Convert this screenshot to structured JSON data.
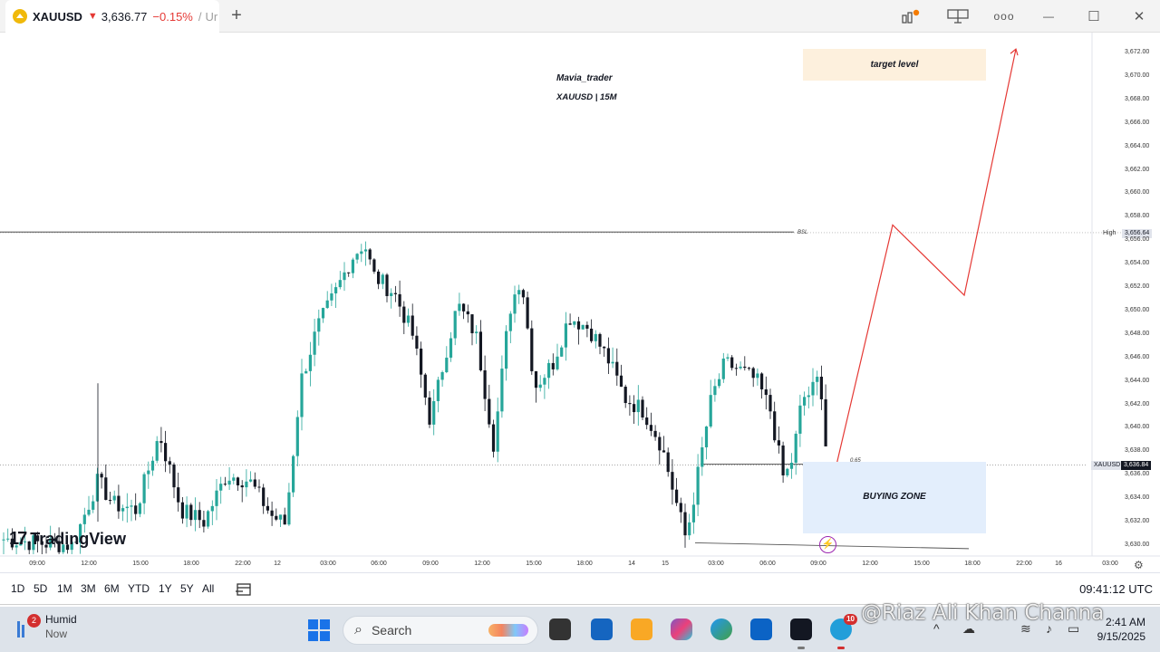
{
  "tab": {
    "symbol": "XAUUSD",
    "arrow": "▼",
    "price": "3,636.77",
    "change": "−0.15%",
    "separator": "/",
    "trail": "Ur"
  },
  "window_controls": {
    "new_tab": "+",
    "more": "ooo",
    "minimize": "—",
    "maximize": "☐",
    "close": "✕"
  },
  "chart": {
    "author": "Mavia_trader",
    "subtitle": "XAUUSD | 15M",
    "target_label": "target level",
    "buying_zone_label": "BUYING ZONE",
    "bsl_label": "BSL",
    "fib_label": "0.65",
    "high_tag": "High",
    "high_value": "3,656.64",
    "price_tag_symbol": "XAUUSD",
    "price_tag_value": "3,636.84",
    "logo_mark": "17",
    "logo_text": "TradingView",
    "zap_icon": "⚡",
    "settings_icon": "⚙",
    "y_ticks": [
      "3,672.00",
      "3,670.00",
      "3,668.00",
      "3,666.00",
      "3,664.00",
      "3,662.00",
      "3,660.00",
      "3,658.00",
      "3,656.00",
      "3,654.00",
      "3,652.00",
      "3,650.00",
      "3,648.00",
      "3,646.00",
      "3,644.00",
      "3,642.00",
      "3,640.00",
      "3,638.00",
      "3,636.00",
      "3,634.00",
      "3,632.00",
      "3,630.00"
    ],
    "x_ticks": [
      "09:00",
      "12:00",
      "15:00",
      "18:00",
      "22:00",
      "12",
      "03:00",
      "06:00",
      "09:00",
      "12:00",
      "15:00",
      "18:00",
      "14",
      "15",
      "03:00",
      "06:00",
      "09:00",
      "12:00",
      "15:00",
      "18:00",
      "22:00",
      "16",
      "03:00"
    ],
    "levels": {
      "bsl": 3656.7,
      "high": 3656.64,
      "current": 3636.84,
      "fib": 3636.9,
      "buy_zone_top": 3637.0,
      "buy_zone_bottom": 3631.0,
      "buy_zone_mid": 3634.2,
      "target_top": 3672.6,
      "target_bottom": 3669.8,
      "low_line_start": 3630.2,
      "low_line_end": 3629.7
    },
    "projection": [
      [
        918,
        3635.2
      ],
      [
        985,
        3657.3
      ],
      [
        1064,
        3651.3
      ],
      [
        1121,
        3672.3
      ]
    ],
    "colors": {
      "bull": "#26a69a",
      "bear": "#131722",
      "projection": "#e53935",
      "buy_zone": "#e3eefc",
      "target_zone": "#fdf0dd"
    }
  },
  "chart_data": {
    "type": "candlestick",
    "title": "XAUUSD | 15M",
    "ylim": [
      3629.0,
      3673.5
    ],
    "y_unit": "USD",
    "anchors": [
      {
        "x": 4,
        "y": 3630.5
      },
      {
        "x": 40,
        "y": 3630.2
      },
      {
        "x": 80,
        "y": 3630.0
      },
      {
        "x": 108,
        "y": 3635.5
      },
      {
        "x": 125,
        "y": 3633.5
      },
      {
        "x": 150,
        "y": 3633.0
      },
      {
        "x": 176,
        "y": 3639.5
      },
      {
        "x": 200,
        "y": 3633.0
      },
      {
        "x": 225,
        "y": 3632.0
      },
      {
        "x": 250,
        "y": 3636.0
      },
      {
        "x": 275,
        "y": 3635.5
      },
      {
        "x": 300,
        "y": 3632.5
      },
      {
        "x": 315,
        "y": 3631.8
      },
      {
        "x": 332,
        "y": 3644.0
      },
      {
        "x": 350,
        "y": 3648.5
      },
      {
        "x": 370,
        "y": 3651.5
      },
      {
        "x": 388,
        "y": 3654.5
      },
      {
        "x": 402,
        "y": 3655.8
      },
      {
        "x": 412,
        "y": 3653.0
      },
      {
        "x": 435,
        "y": 3651.5
      },
      {
        "x": 455,
        "y": 3648.0
      },
      {
        "x": 475,
        "y": 3640.5
      },
      {
        "x": 492,
        "y": 3646.5
      },
      {
        "x": 505,
        "y": 3650.5
      },
      {
        "x": 525,
        "y": 3648.0
      },
      {
        "x": 545,
        "y": 3638.5
      },
      {
        "x": 562,
        "y": 3650.0
      },
      {
        "x": 575,
        "y": 3653.0
      },
      {
        "x": 590,
        "y": 3643.5
      },
      {
        "x": 610,
        "y": 3645.5
      },
      {
        "x": 628,
        "y": 3649.5
      },
      {
        "x": 650,
        "y": 3648.5
      },
      {
        "x": 670,
        "y": 3646.0
      },
      {
        "x": 690,
        "y": 3642.5
      },
      {
        "x": 710,
        "y": 3641.5
      },
      {
        "x": 730,
        "y": 3638.5
      },
      {
        "x": 745,
        "y": 3634.0
      },
      {
        "x": 757,
        "y": 3630.5
      },
      {
        "x": 770,
        "y": 3636.0
      },
      {
        "x": 785,
        "y": 3642.5
      },
      {
        "x": 800,
        "y": 3645.5
      },
      {
        "x": 815,
        "y": 3645.0
      },
      {
        "x": 835,
        "y": 3644.0
      },
      {
        "x": 850,
        "y": 3641.5
      },
      {
        "x": 865,
        "y": 3635.5
      },
      {
        "x": 875,
        "y": 3637.5
      },
      {
        "x": 885,
        "y": 3642.5
      },
      {
        "x": 895,
        "y": 3643.0
      },
      {
        "x": 905,
        "y": 3644.5
      },
      {
        "x": 913,
        "y": 3636.8
      }
    ]
  },
  "timeframes": [
    "1D",
    "5D",
    "1M",
    "3M",
    "6M",
    "YTD",
    "1Y",
    "5Y",
    "All"
  ],
  "utc_time": "09:41:12 UTC",
  "taskbar": {
    "weather_badge": "2",
    "weather_title": "Humid",
    "weather_sub": "Now",
    "search_placeholder": "Search",
    "watermark": "@Riaz Ali Khan Channa",
    "telegram_badge": "10",
    "time": "2:41 AM",
    "date": "9/15/2025"
  }
}
